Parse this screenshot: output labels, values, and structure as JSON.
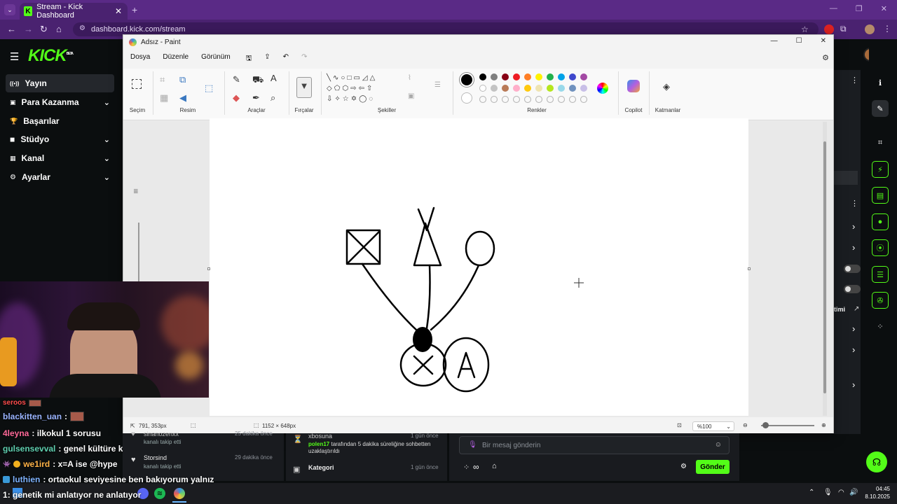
{
  "browser": {
    "tab_title": "Stream - Kick Dashboard",
    "tab_favicon": "K",
    "tab_close": "✕",
    "new_tab": "+",
    "url": "dashboard.kick.com/stream",
    "win_min": "—",
    "win_restore": "❐",
    "win_close": "✕"
  },
  "kick": {
    "logo": "KICK",
    "logo_badge": "BETA",
    "nav": [
      {
        "label": "Yayın",
        "icon": "((•))"
      },
      {
        "label": "Para Kazanma",
        "icon": "▣"
      },
      {
        "label": "Başarılar",
        "icon": "🏆"
      },
      {
        "label": "Stüdyo",
        "icon": "◼"
      },
      {
        "label": "Kanal",
        "icon": "▦"
      },
      {
        "label": "Ayarlar",
        "icon": "⚙"
      }
    ],
    "right_partial_text": "timi"
  },
  "paint": {
    "title": "Adsız - Paint",
    "menu": [
      "Dosya",
      "Düzenle",
      "Görünüm"
    ],
    "groups": [
      "Seçim",
      "Resim",
      "Araçlar",
      "Fırçalar",
      "Şekiller",
      "Renkler",
      "Copilot",
      "Katmanlar"
    ],
    "colors_row1": [
      "#000000",
      "#7f7f7f",
      "#880015",
      "#ed1c24",
      "#ff7f27",
      "#fff200",
      "#22b14c",
      "#00a2e8",
      "#3f48cc",
      "#a349a4"
    ],
    "colors_row2": [
      "#ffffff",
      "#c3c3c3",
      "#b97a57",
      "#ffaec9",
      "#ffc90e",
      "#efe4b0",
      "#b5e61d",
      "#99d9ea",
      "#7092be",
      "#c8bfe7"
    ],
    "status": {
      "cursor": "791, 353px",
      "canvas_size": "1152 × 648px",
      "zoom": "%100"
    }
  },
  "chat_overlay": [
    {
      "user": "seroos",
      "color": "#ff4c4c",
      "text": ""
    },
    {
      "user": "blackitten_uan",
      "color": "#9ab4ff",
      "text": ":"
    },
    {
      "user": "4leyna",
      "color": "#ff6a9a",
      "text": ": ilkokul 1 sorusu"
    },
    {
      "user": "gulsensevval",
      "color": "#5fd0b0",
      "text": ": genel kültüre katkı sağlar mı hocam"
    },
    {
      "user": "we1ird",
      "color": "#ffb347",
      "text": ": x=A ise @hype"
    },
    {
      "user": "luthien",
      "color": "#7fb3ff",
      "text": ": ortaokul seviyesine ben bakıyorum yalnız"
    },
    {
      "user": "1",
      "color": "#ffffff",
      "text": ": genetik mi anlatıyor ne anlatıyor"
    }
  ],
  "activity": {
    "rows": [
      {
        "name": "sinanozenxx",
        "sub": "kanalı takip etti",
        "time": "25 dakika önce"
      },
      {
        "name": "Storsind",
        "sub": "kanalı takip etti",
        "time": "29 dakika önce"
      }
    ],
    "events": [
      {
        "name": "xbosuna",
        "time": "1 gün önce"
      },
      {
        "name": "polen17",
        "detail": "tarafından 5 dakika süreliğine sohbetten uzaklaştırıldı",
        "time": ""
      },
      {
        "name": "Kategori",
        "time": "1 gün önce"
      }
    ]
  },
  "chat": {
    "placeholder": "Bir mesaj gönderin",
    "send": "Gönder"
  },
  "taskbar": {
    "time": "04:45",
    "date": "8.10.2025"
  }
}
